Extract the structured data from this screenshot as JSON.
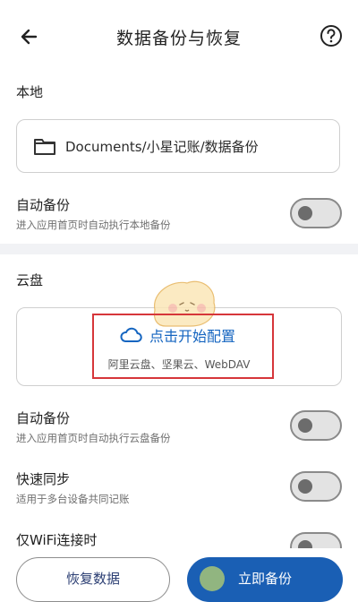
{
  "header": {
    "title": "数据备份与恢复",
    "back_icon": "arrow-left-icon",
    "help_icon": "help-circle-icon"
  },
  "local": {
    "section_label": "本地",
    "path": "Documents/小星记账/数据备份",
    "path_icon": "folder-icon",
    "auto_backup_title": "自动备份",
    "auto_backup_desc": "进入应用首页时自动执行本地备份",
    "auto_backup_on": false
  },
  "cloud": {
    "section_label": "云盘",
    "config_title": "点击开始配置",
    "config_sub": "阿里云盘、坚果云、WebDAV",
    "cloud_icon": "cloud-icon",
    "auto_backup_title": "自动备份",
    "auto_backup_desc": "进入应用首页时自动执行云盘备份",
    "auto_backup_on": false,
    "quick_sync_title": "快速同步",
    "quick_sync_desc": "适用于多台设备共同记账",
    "quick_sync_on": false,
    "wifi_only_title": "仅WiFi连接时",
    "wifi_only_on": false
  },
  "actions": {
    "restore_label": "恢复数据",
    "backup_label": "立即备份"
  },
  "colors": {
    "accent": "#1a5fb4",
    "link": "#1565c0",
    "highlight": "#d6363a",
    "divider": "#f1f2f5"
  }
}
